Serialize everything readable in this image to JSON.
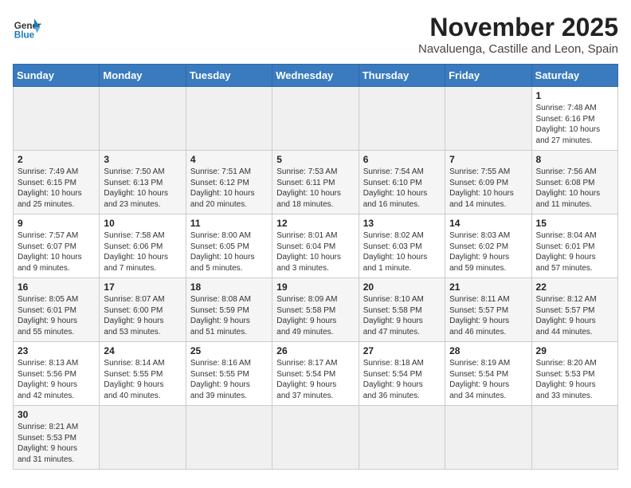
{
  "logo": {
    "line1": "General",
    "line2": "Blue"
  },
  "title": "November 2025",
  "subtitle": "Navaluenga, Castille and Leon, Spain",
  "weekdays": [
    "Sunday",
    "Monday",
    "Tuesday",
    "Wednesday",
    "Thursday",
    "Friday",
    "Saturday"
  ],
  "weeks": [
    [
      {
        "day": "",
        "info": ""
      },
      {
        "day": "",
        "info": ""
      },
      {
        "day": "",
        "info": ""
      },
      {
        "day": "",
        "info": ""
      },
      {
        "day": "",
        "info": ""
      },
      {
        "day": "",
        "info": ""
      },
      {
        "day": "1",
        "info": "Sunrise: 7:48 AM\nSunset: 6:16 PM\nDaylight: 10 hours\nand 27 minutes."
      }
    ],
    [
      {
        "day": "2",
        "info": "Sunrise: 7:49 AM\nSunset: 6:15 PM\nDaylight: 10 hours\nand 25 minutes."
      },
      {
        "day": "3",
        "info": "Sunrise: 7:50 AM\nSunset: 6:13 PM\nDaylight: 10 hours\nand 23 minutes."
      },
      {
        "day": "4",
        "info": "Sunrise: 7:51 AM\nSunset: 6:12 PM\nDaylight: 10 hours\nand 20 minutes."
      },
      {
        "day": "5",
        "info": "Sunrise: 7:53 AM\nSunset: 6:11 PM\nDaylight: 10 hours\nand 18 minutes."
      },
      {
        "day": "6",
        "info": "Sunrise: 7:54 AM\nSunset: 6:10 PM\nDaylight: 10 hours\nand 16 minutes."
      },
      {
        "day": "7",
        "info": "Sunrise: 7:55 AM\nSunset: 6:09 PM\nDaylight: 10 hours\nand 14 minutes."
      },
      {
        "day": "8",
        "info": "Sunrise: 7:56 AM\nSunset: 6:08 PM\nDaylight: 10 hours\nand 11 minutes."
      }
    ],
    [
      {
        "day": "9",
        "info": "Sunrise: 7:57 AM\nSunset: 6:07 PM\nDaylight: 10 hours\nand 9 minutes."
      },
      {
        "day": "10",
        "info": "Sunrise: 7:58 AM\nSunset: 6:06 PM\nDaylight: 10 hours\nand 7 minutes."
      },
      {
        "day": "11",
        "info": "Sunrise: 8:00 AM\nSunset: 6:05 PM\nDaylight: 10 hours\nand 5 minutes."
      },
      {
        "day": "12",
        "info": "Sunrise: 8:01 AM\nSunset: 6:04 PM\nDaylight: 10 hours\nand 3 minutes."
      },
      {
        "day": "13",
        "info": "Sunrise: 8:02 AM\nSunset: 6:03 PM\nDaylight: 10 hours\nand 1 minute."
      },
      {
        "day": "14",
        "info": "Sunrise: 8:03 AM\nSunset: 6:02 PM\nDaylight: 9 hours\nand 59 minutes."
      },
      {
        "day": "15",
        "info": "Sunrise: 8:04 AM\nSunset: 6:01 PM\nDaylight: 9 hours\nand 57 minutes."
      }
    ],
    [
      {
        "day": "16",
        "info": "Sunrise: 8:05 AM\nSunset: 6:01 PM\nDaylight: 9 hours\nand 55 minutes."
      },
      {
        "day": "17",
        "info": "Sunrise: 8:07 AM\nSunset: 6:00 PM\nDaylight: 9 hours\nand 53 minutes."
      },
      {
        "day": "18",
        "info": "Sunrise: 8:08 AM\nSunset: 5:59 PM\nDaylight: 9 hours\nand 51 minutes."
      },
      {
        "day": "19",
        "info": "Sunrise: 8:09 AM\nSunset: 5:58 PM\nDaylight: 9 hours\nand 49 minutes."
      },
      {
        "day": "20",
        "info": "Sunrise: 8:10 AM\nSunset: 5:58 PM\nDaylight: 9 hours\nand 47 minutes."
      },
      {
        "day": "21",
        "info": "Sunrise: 8:11 AM\nSunset: 5:57 PM\nDaylight: 9 hours\nand 46 minutes."
      },
      {
        "day": "22",
        "info": "Sunrise: 8:12 AM\nSunset: 5:57 PM\nDaylight: 9 hours\nand 44 minutes."
      }
    ],
    [
      {
        "day": "23",
        "info": "Sunrise: 8:13 AM\nSunset: 5:56 PM\nDaylight: 9 hours\nand 42 minutes."
      },
      {
        "day": "24",
        "info": "Sunrise: 8:14 AM\nSunset: 5:55 PM\nDaylight: 9 hours\nand 40 minutes."
      },
      {
        "day": "25",
        "info": "Sunrise: 8:16 AM\nSunset: 5:55 PM\nDaylight: 9 hours\nand 39 minutes."
      },
      {
        "day": "26",
        "info": "Sunrise: 8:17 AM\nSunset: 5:54 PM\nDaylight: 9 hours\nand 37 minutes."
      },
      {
        "day": "27",
        "info": "Sunrise: 8:18 AM\nSunset: 5:54 PM\nDaylight: 9 hours\nand 36 minutes."
      },
      {
        "day": "28",
        "info": "Sunrise: 8:19 AM\nSunset: 5:54 PM\nDaylight: 9 hours\nand 34 minutes."
      },
      {
        "day": "29",
        "info": "Sunrise: 8:20 AM\nSunset: 5:53 PM\nDaylight: 9 hours\nand 33 minutes."
      }
    ],
    [
      {
        "day": "30",
        "info": "Sunrise: 8:21 AM\nSunset: 5:53 PM\nDaylight: 9 hours\nand 31 minutes."
      },
      {
        "day": "",
        "info": ""
      },
      {
        "day": "",
        "info": ""
      },
      {
        "day": "",
        "info": ""
      },
      {
        "day": "",
        "info": ""
      },
      {
        "day": "",
        "info": ""
      },
      {
        "day": "",
        "info": ""
      }
    ]
  ]
}
